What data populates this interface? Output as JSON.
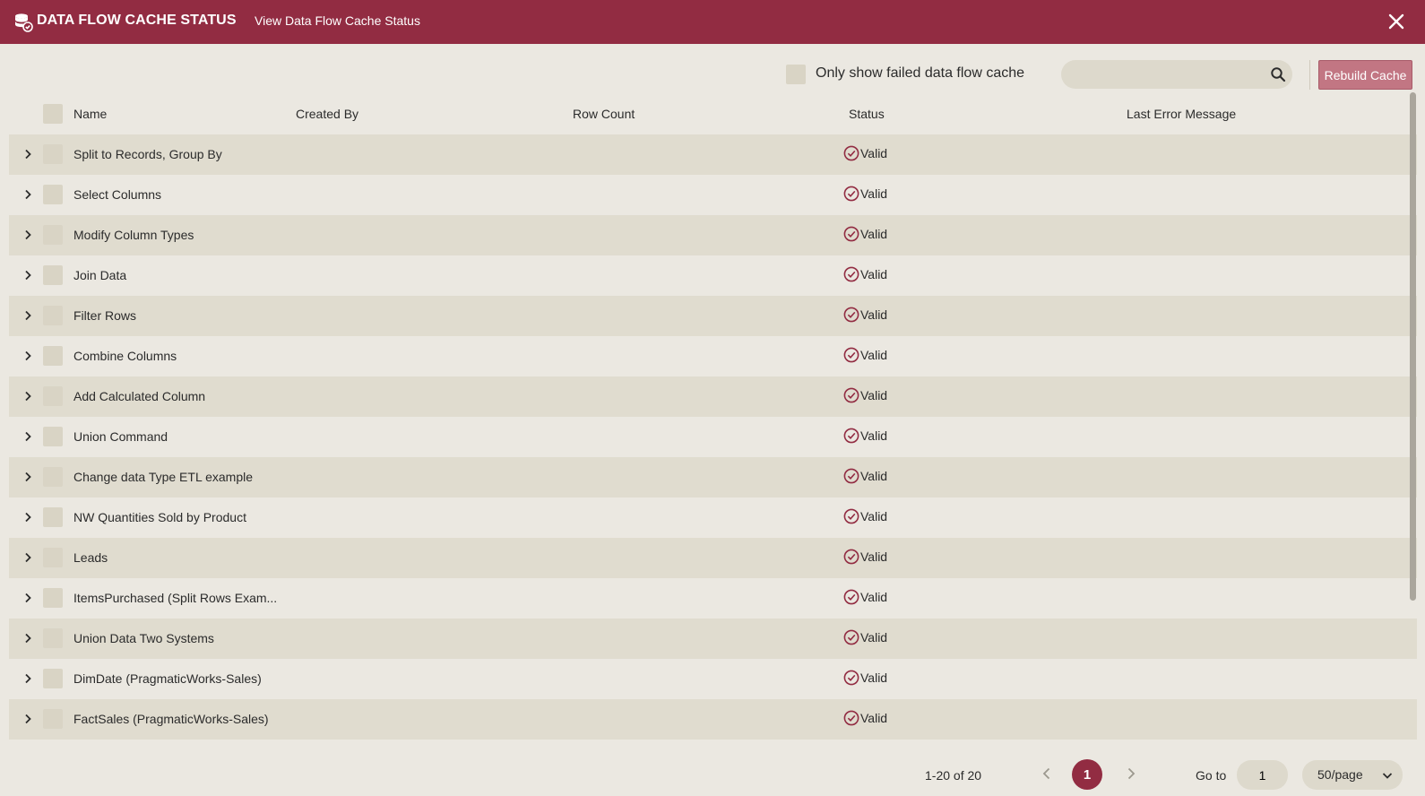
{
  "header": {
    "title": "DATA FLOW CACHE STATUS",
    "subtitle": "View Data Flow Cache Status"
  },
  "toolbar": {
    "filter_label": "Only show failed data flow cache",
    "search_placeholder": "",
    "rebuild_label": "Rebuild Cache"
  },
  "table": {
    "columns": [
      "Name",
      "Created By",
      "Row Count",
      "Status",
      "Last Error Message"
    ],
    "rows": [
      {
        "name": "Split to Records, Group By",
        "status": "Valid"
      },
      {
        "name": "Select Columns",
        "status": "Valid"
      },
      {
        "name": "Modify Column Types",
        "status": "Valid"
      },
      {
        "name": "Join Data",
        "status": "Valid"
      },
      {
        "name": "Filter Rows",
        "status": "Valid"
      },
      {
        "name": "Combine Columns",
        "status": "Valid"
      },
      {
        "name": "Add Calculated Column",
        "status": "Valid"
      },
      {
        "name": "Union Command",
        "status": "Valid"
      },
      {
        "name": "Change data Type ETL example",
        "status": "Valid"
      },
      {
        "name": "NW Quantities Sold by Product",
        "status": "Valid"
      },
      {
        "name": "Leads",
        "status": "Valid"
      },
      {
        "name": "ItemsPurchased (Split Rows Exam...",
        "status": "Valid"
      },
      {
        "name": "Union Data Two Systems",
        "status": "Valid"
      },
      {
        "name": "DimDate (PragmaticWorks-Sales)",
        "status": "Valid"
      },
      {
        "name": "FactSales (PragmaticWorks-Sales)",
        "status": "Valid"
      }
    ]
  },
  "pagination": {
    "summary": "1-20 of 20",
    "current_page": "1",
    "goto_label": "Go to",
    "goto_value": "1",
    "per_page": "50/page"
  },
  "colors": {
    "brand": "#922c42",
    "accent_button": "#c27683",
    "row_alt": "#e0dccf",
    "background": "#ebe8e1"
  },
  "icons": {
    "logo": "database-cache-icon",
    "close": "close-icon",
    "search": "search-icon",
    "status_valid": "check-circle-icon",
    "expand": "chevron-right-icon"
  }
}
